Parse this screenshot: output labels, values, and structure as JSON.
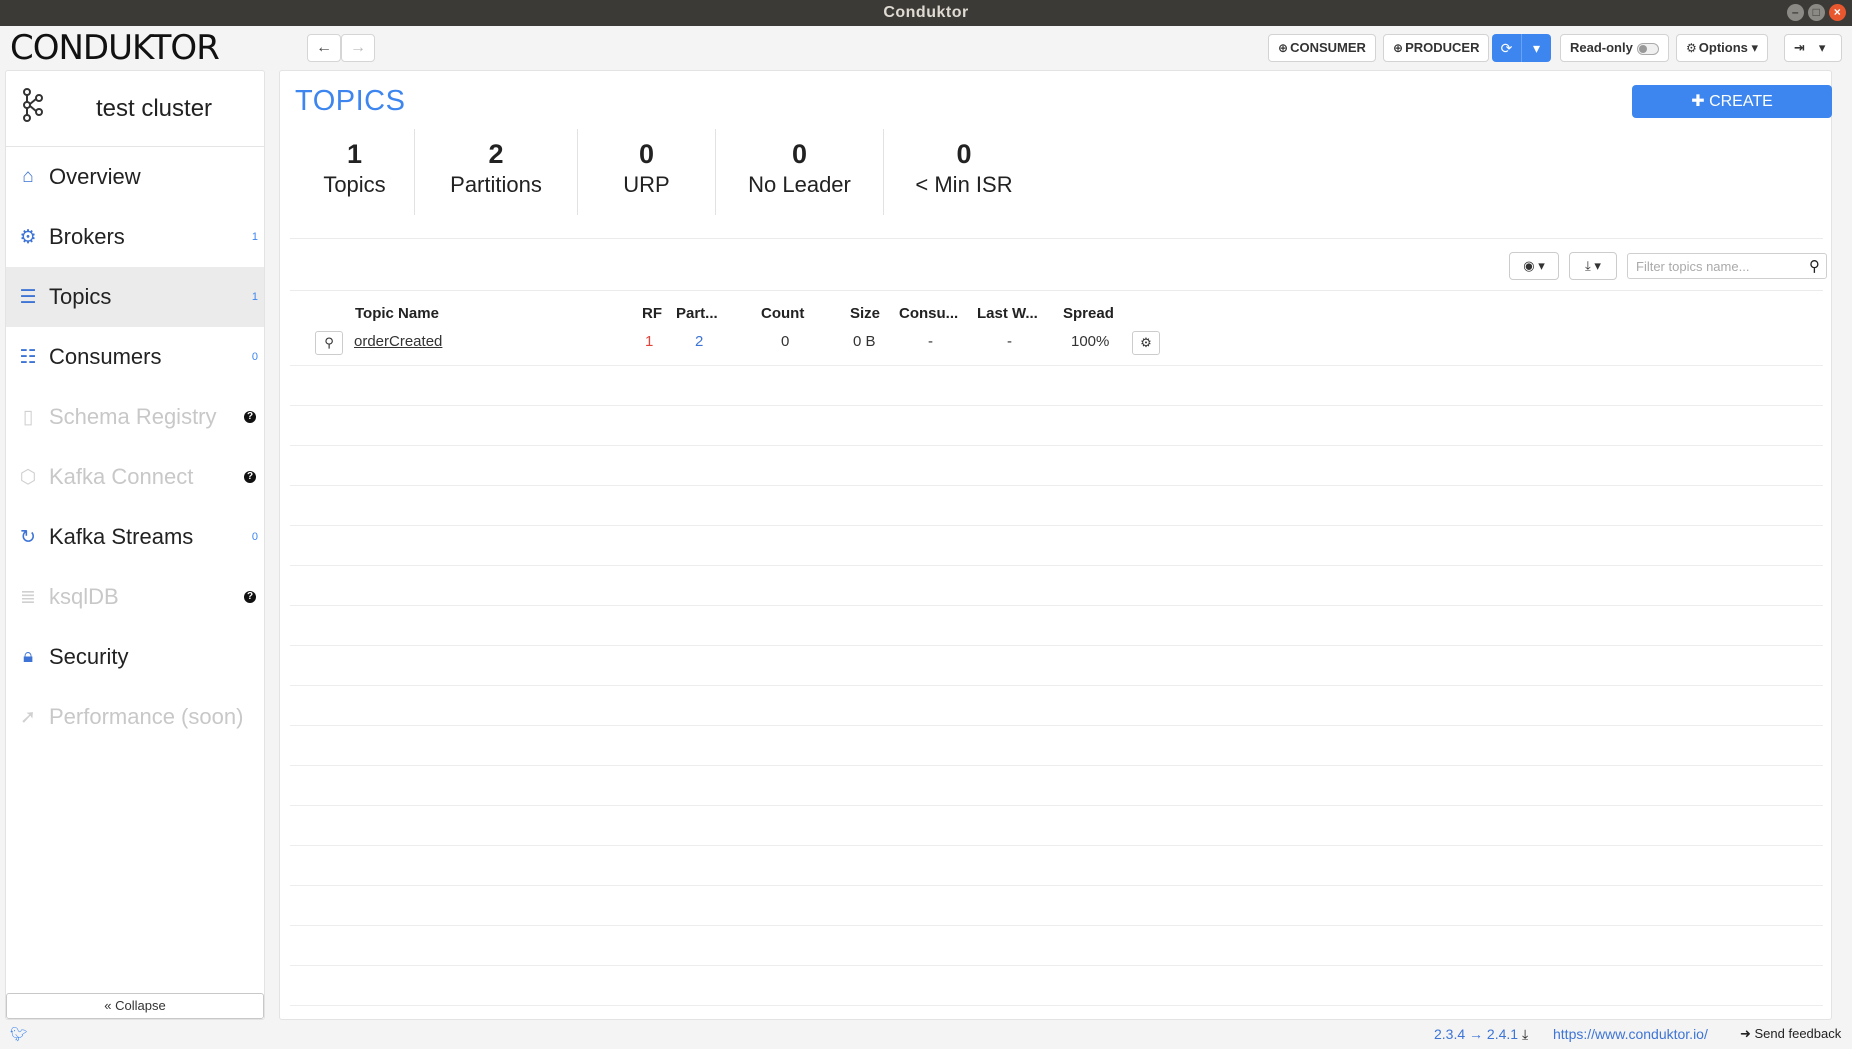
{
  "window": {
    "title": "Conduktor",
    "btn_min": "–",
    "btn_max": "□",
    "btn_close": "×"
  },
  "toolbar": {
    "logo": "CONDUKTOR",
    "back": "←",
    "forward": "→",
    "consumer": "CONSUMER",
    "producer": "PRODUCER",
    "readonly": "Read-only",
    "options": "Options"
  },
  "sidebar": {
    "cluster_name": "test cluster",
    "items": [
      {
        "label": "Overview",
        "count": ""
      },
      {
        "label": "Brokers",
        "count": "1"
      },
      {
        "label": "Topics",
        "count": "1"
      },
      {
        "label": "Consumers",
        "count": "0"
      },
      {
        "label": "Schema Registry",
        "count": ""
      },
      {
        "label": "Kafka Connect",
        "count": ""
      },
      {
        "label": "Kafka Streams",
        "count": "0"
      },
      {
        "label": "ksqlDB",
        "count": ""
      },
      {
        "label": "Security",
        "count": ""
      },
      {
        "label": "Performance (soon)",
        "count": ""
      }
    ],
    "collapse": "« Collapse"
  },
  "main": {
    "title": "TOPICS",
    "create": "CREATE",
    "stats": [
      {
        "value": "1",
        "label": "Topics"
      },
      {
        "value": "2",
        "label": "Partitions"
      },
      {
        "value": "0",
        "label": "URP"
      },
      {
        "value": "0",
        "label": "No Leader"
      },
      {
        "value": "0",
        "label": "< Min ISR"
      }
    ],
    "filter_placeholder": "Filter topics name...",
    "columns": {
      "name": "Topic Name",
      "rf": "RF",
      "partitions": "Part...",
      "count": "Count",
      "size": "Size",
      "consumers": "Consu...",
      "last_write": "Last W...",
      "spread": "Spread"
    },
    "rows": [
      {
        "name": "orderCreated",
        "rf": "1",
        "partitions": "2",
        "count": "0",
        "size": "0 B",
        "consumers": "-",
        "last_write": "-",
        "spread": "100%"
      }
    ]
  },
  "footer": {
    "version": "2.3.4 → 2.4.1",
    "url": "https://www.conduktor.io/",
    "feedback": "Send feedback"
  },
  "colors": {
    "accent": "#3d86ef",
    "rf_red": "#e0443a"
  }
}
